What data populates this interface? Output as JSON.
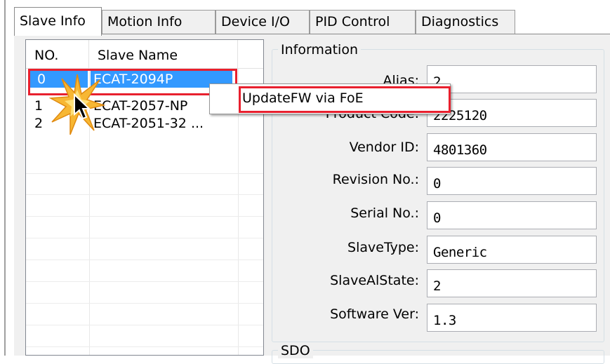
{
  "tabs": [
    {
      "label": "Slave Info",
      "active": true
    },
    {
      "label": "Motion Info",
      "active": false
    },
    {
      "label": "Device I/O",
      "active": false
    },
    {
      "label": "PID Control",
      "active": false
    },
    {
      "label": "Diagnostics",
      "active": false
    }
  ],
  "slave_list": {
    "columns": [
      "NO.",
      "Slave Name"
    ],
    "rows": [
      {
        "no": "0",
        "name": "ECAT-2094P",
        "selected": true
      },
      {
        "no": "1",
        "name": "ECAT-2057-NP",
        "selected": false
      },
      {
        "no": "2",
        "name": "ECAT-2051-32 ...",
        "selected": false
      }
    ]
  },
  "context_menu": {
    "items": [
      "UpdateFW via FoE"
    ]
  },
  "information": {
    "title": "Information",
    "fields": [
      {
        "label": "Alias:",
        "value": "2"
      },
      {
        "label": "Product Code:",
        "value": "2225120"
      },
      {
        "label": "Vendor ID:",
        "value": "4801360"
      },
      {
        "label": "Revision No.:",
        "value": "0"
      },
      {
        "label": "Serial No.:",
        "value": "0"
      },
      {
        "label": "SlaveType:",
        "value": "Generic"
      },
      {
        "label": "SlaveAlState:",
        "value": "2"
      },
      {
        "label": "Software Ver:",
        "value": "1.3"
      }
    ]
  },
  "sdo": {
    "title": "SDO"
  },
  "colors": {
    "selection": "#3399ff",
    "highlight_box": "#e8202e",
    "panel": "#f0f0f0"
  },
  "icons": {
    "pointer": "arrow-cursor-icon",
    "click": "click-burst-icon"
  }
}
